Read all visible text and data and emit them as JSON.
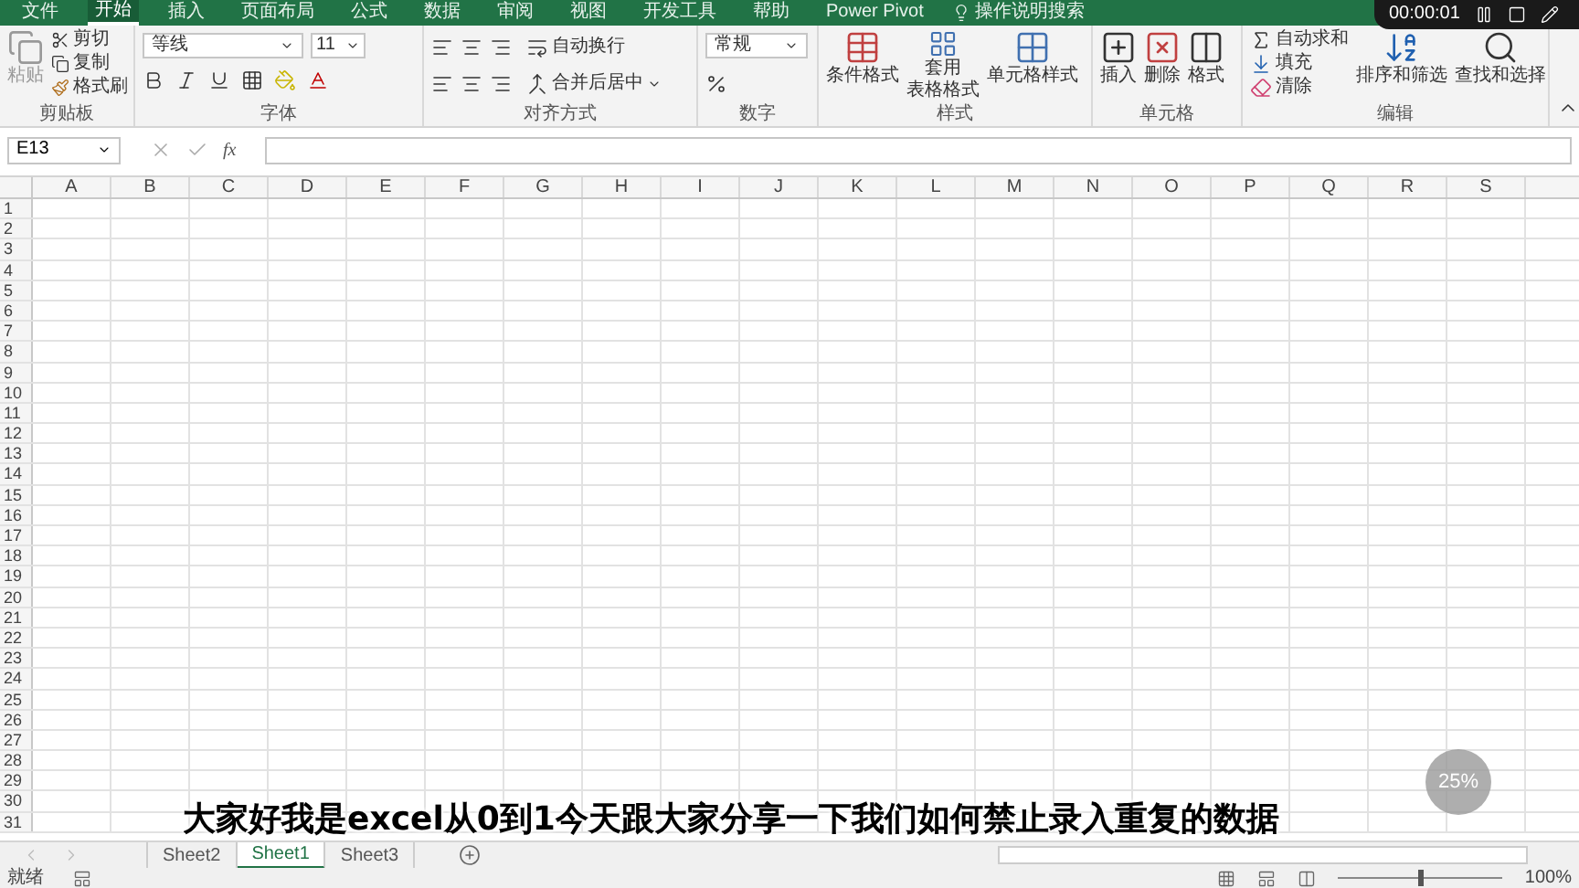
{
  "ribbon_tabs": [
    {
      "label": "文件",
      "selected": false
    },
    {
      "label": "开始",
      "selected": true
    },
    {
      "label": "插入",
      "selected": false
    },
    {
      "label": "页面布局",
      "selected": false
    },
    {
      "label": "公式",
      "selected": false
    },
    {
      "label": "数据",
      "selected": false
    },
    {
      "label": "审阅",
      "selected": false
    },
    {
      "label": "视图",
      "selected": false
    },
    {
      "label": "开发工具",
      "selected": false
    },
    {
      "label": "帮助",
      "selected": false
    },
    {
      "label": "Power Pivot",
      "selected": false
    }
  ],
  "tell_me": "操作说明搜索",
  "clipboard": {
    "paste": "粘贴",
    "cut": "剪切",
    "copy": "复制",
    "painter": "格式刷",
    "title": "剪贴板"
  },
  "font": {
    "name": "等线",
    "size": "11",
    "title": "字体"
  },
  "alignment": {
    "wrap": "自动换行",
    "merge": "合并后居中",
    "title": "对齐方式"
  },
  "number": {
    "format": "常规",
    "title": "数字"
  },
  "styles": {
    "conditional": "条件格式",
    "table_1": "套用",
    "table_2": "表格格式",
    "cell": "单元格样式",
    "title": "样式"
  },
  "cells": {
    "insert": "插入",
    "delete": "删除",
    "format": "格式",
    "title": "单元格"
  },
  "editing": {
    "autosum": "自动求和",
    "fill": "填充",
    "clear": "清除",
    "sort": "排序和筛选",
    "find": "查找和选择",
    "title": "编辑"
  },
  "name_box": "E13",
  "fx": "fx",
  "columns": [
    "A",
    "B",
    "C",
    "D",
    "E",
    "F",
    "G",
    "H",
    "I",
    "J",
    "K",
    "L",
    "M",
    "N",
    "O",
    "P",
    "Q",
    "R",
    "S"
  ],
  "rows": [
    "1",
    "2",
    "3",
    "4",
    "5",
    "6",
    "7",
    "8",
    "9",
    "10",
    "11",
    "12",
    "13",
    "14",
    "15",
    "16",
    "17",
    "18",
    "19",
    "20",
    "21",
    "22",
    "23",
    "24",
    "25",
    "26",
    "27",
    "28",
    "29",
    "30",
    "31"
  ],
  "sheets": [
    {
      "label": "Sheet2",
      "selected": false
    },
    {
      "label": "Sheet1",
      "selected": true
    },
    {
      "label": "Sheet3",
      "selected": false
    }
  ],
  "status": "就绪",
  "zoom": {
    "level": 0.5,
    "reading": "100%"
  },
  "recorder": {
    "time": "00:00:01"
  },
  "speed_widget": {
    "percent": "25%"
  },
  "subtitle": "大家好我是excel从0到1今天跟大家分享一下我们如何禁止录入重复的数据"
}
